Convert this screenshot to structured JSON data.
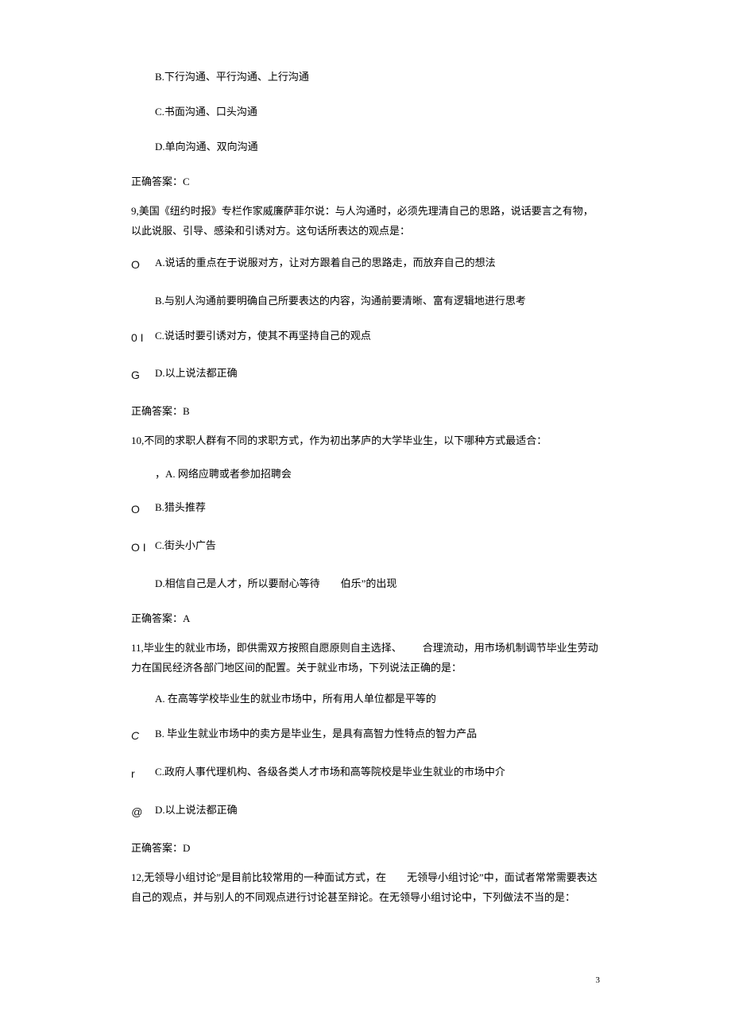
{
  "q8": {
    "optB": "B.下行沟通、平行沟通、上行沟通",
    "optC": "C.书面沟通、口头沟通",
    "optD": "D.单向沟通、双向沟通",
    "answer": "正确答案：C"
  },
  "q9": {
    "stem": "9,美国《纽约时报》专栏作家威廉萨菲尔说：与人沟通时，必须先理清自己的思路，说话要言之有物，以此说服、引导、感染和引诱对方。这句话所表达的观点是：",
    "markerA": "O",
    "optA": "A.说话的重点在于说服对方，让对方跟着自己的思路走，而放弃自己的想法",
    "optB": "B.与别人沟通前要明确自己所要表达的内容，沟通前要清晰、富有逻辑地进行思考",
    "markerC": "0 I",
    "optC": "C.说话时要引诱对方，使其不再坚持自己的观点",
    "markerD": "G",
    "optD": "D.以上说法都正确",
    "answer": "正确答案：B"
  },
  "q10": {
    "stem": "10,不同的求职人群有不同的求职方式，作为初出茅庐的大学毕业生，以下哪种方式最适合：",
    "optA": "，A. 网络应聘或者参加招聘会",
    "markerB": "O",
    "optB": "B.猎头推荐",
    "markerC": "O I",
    "optC": "C.街头小广告",
    "optD": "D.相信自己是人才，所以要耐心等待  伯乐”的出现",
    "answer": "正确答案：A"
  },
  "q11": {
    "stem": "11,毕业生的就业市场，即供需双方按照自愿原则自主选择、  合理流动，用市场机制调节毕业生劳动力在国民经济各部门地区间的配置。关于就业市场，下列说法正确的是：",
    "optA": "A. 在高等学校毕业生的就业市场中，所有用人单位都是平等的",
    "markerB": "C",
    "optB": "B. 毕业生就业市场中的卖方是毕业生，是具有高智力性特点的智力产品",
    "markerC": "r",
    "optC": "C.政府人事代理机构、各级各类人才市场和高等院校是毕业生就业的市场中介",
    "markerD": "@",
    "optD": "D.以上说法都正确",
    "answer": "正确答案：D"
  },
  "q12": {
    "stem": "12,无领导小组讨论”是目前比较常用的一种面试方式，在  无领导小组讨论”中，面试者常常需要表达自己的观点，并与别人的不同观点进行讨论甚至辩论。在无领导小组讨论中，下列做法不当的是："
  },
  "pageNumber": "3"
}
